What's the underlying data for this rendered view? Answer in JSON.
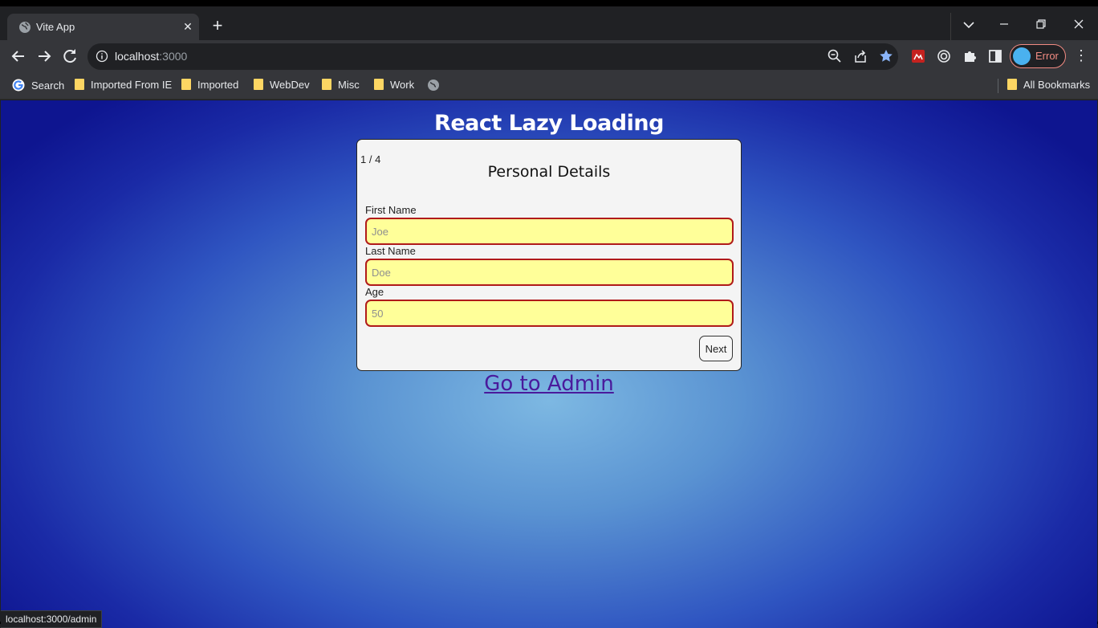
{
  "browser": {
    "tab_title": "Vite App",
    "tab_close": "✕",
    "new_tab": "+",
    "url_host": "localhost",
    "url_port": ":3000",
    "profile_status": "Error",
    "status_bar": "localhost:3000/admin"
  },
  "bookmarks": {
    "items": [
      "Search",
      "Imported From IE",
      "Imported",
      "WebDev",
      "Misc",
      "Work"
    ],
    "all": "All Bookmarks"
  },
  "page": {
    "title": "React Lazy Loading",
    "step": "1 / 4",
    "form_title": "Personal Details",
    "fields": [
      {
        "label": "First Name",
        "placeholder": "Joe"
      },
      {
        "label": "Last Name",
        "placeholder": "Doe"
      },
      {
        "label": "Age",
        "placeholder": "50"
      }
    ],
    "next_label": "Next",
    "admin_link": "Go to Admin"
  }
}
